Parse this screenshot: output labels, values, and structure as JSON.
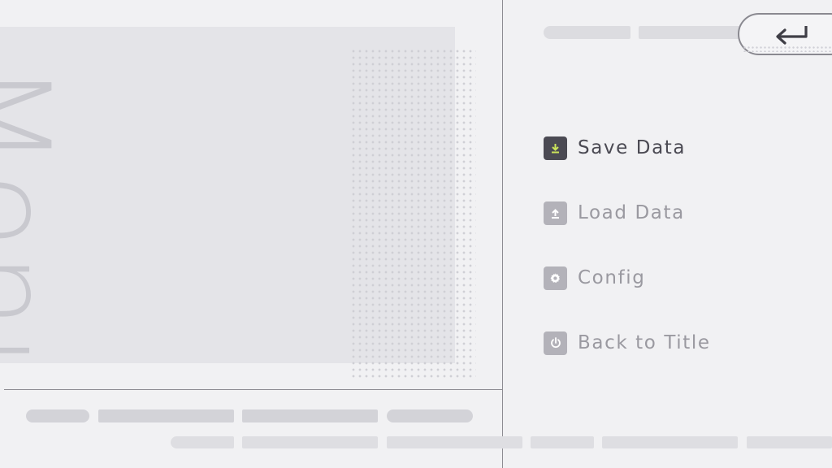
{
  "screen": {
    "watermark_text": "Menu"
  },
  "menu": {
    "items": [
      {
        "label": "Save Data",
        "icon": "download-icon",
        "active": true
      },
      {
        "label": "Load Data",
        "icon": "upload-icon",
        "active": false
      },
      {
        "label": "Config",
        "icon": "gear-icon",
        "active": false
      },
      {
        "label": "Back to Title",
        "icon": "power-icon",
        "active": false
      }
    ]
  },
  "back_button": {
    "icon": "return-arrow-icon"
  },
  "colors": {
    "background": "#f1f1f3",
    "panel": "#e4e4e8",
    "active_text": "#4b4a53",
    "inactive_text": "#9a99a0",
    "accent": "#cbe35a"
  }
}
